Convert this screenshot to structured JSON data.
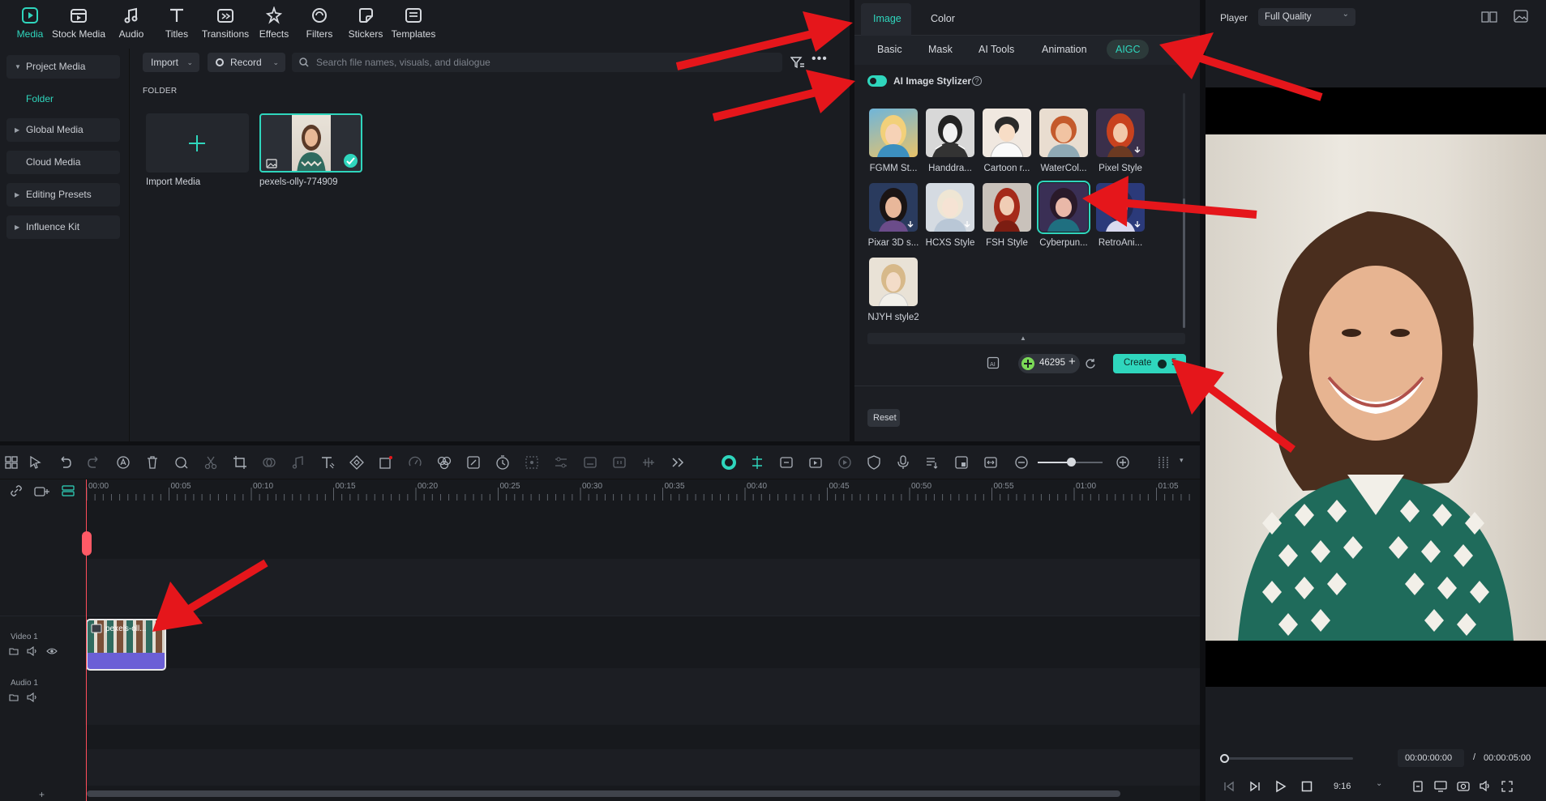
{
  "toolbar": {
    "items": [
      {
        "label": "Media",
        "icon": "media-icon"
      },
      {
        "label": "Stock Media",
        "icon": "stock-media-icon"
      },
      {
        "label": "Audio",
        "icon": "music-note-icon"
      },
      {
        "label": "Titles",
        "icon": "titles-icon"
      },
      {
        "label": "Transitions",
        "icon": "transitions-icon"
      },
      {
        "label": "Effects",
        "icon": "effects-icon"
      },
      {
        "label": "Filters",
        "icon": "filters-icon"
      },
      {
        "label": "Stickers",
        "icon": "stickers-icon"
      },
      {
        "label": "Templates",
        "icon": "templates-icon"
      }
    ]
  },
  "sidebar": {
    "items": [
      {
        "label": "Project Media"
      },
      {
        "label": "Folder"
      },
      {
        "label": "Global Media"
      },
      {
        "label": "Cloud Media"
      },
      {
        "label": "Editing Presets"
      },
      {
        "label": "Influence Kit"
      }
    ]
  },
  "media": {
    "import_label": "Import",
    "record_label": "Record",
    "search_placeholder": "Search file names, visuals, and dialogue",
    "folder_label": "FOLDER",
    "import_media_label": "Import Media",
    "clip_name": "pexels-olly-774909"
  },
  "props": {
    "top_tabs": [
      "Image",
      "Color"
    ],
    "sub_tabs": [
      "Basic",
      "Mask",
      "AI Tools",
      "Animation",
      "AIGC"
    ],
    "stylizer_label": "AI Image Stylizer",
    "styles": [
      "FGMM St...",
      "Handdra...",
      "Cartoon r...",
      "WaterCol...",
      "Pixel Style",
      "Pixar 3D s...",
      "HCXS Style",
      "FSH Style",
      "Cyberpun...",
      "RetroAni...",
      "NJYH style2"
    ],
    "credits": "46295",
    "create_label": "Create",
    "create_cost": "5",
    "reset_label": "Reset"
  },
  "player": {
    "label": "Player",
    "quality": "Full Quality",
    "current_time": "00:00:00:00",
    "separator": "/",
    "total_time": "00:00:05:00",
    "ratio": "9:16"
  },
  "timeline": {
    "ticks": [
      "00:00",
      "00:05",
      "00:10",
      "00:15",
      "00:20",
      "00:25",
      "00:30",
      "00:35",
      "00:40",
      "00:45",
      "00:50",
      "00:55",
      "01:00",
      "01:05"
    ],
    "video_track": "Video 1",
    "audio_track": "Audio 1",
    "clip_label": "pexels-oll..."
  },
  "colors": {
    "accent": "#2fd6bd",
    "arrow": "#e5161b",
    "panel": "#1a1c21",
    "clip_purple": "#6b5fd6"
  }
}
